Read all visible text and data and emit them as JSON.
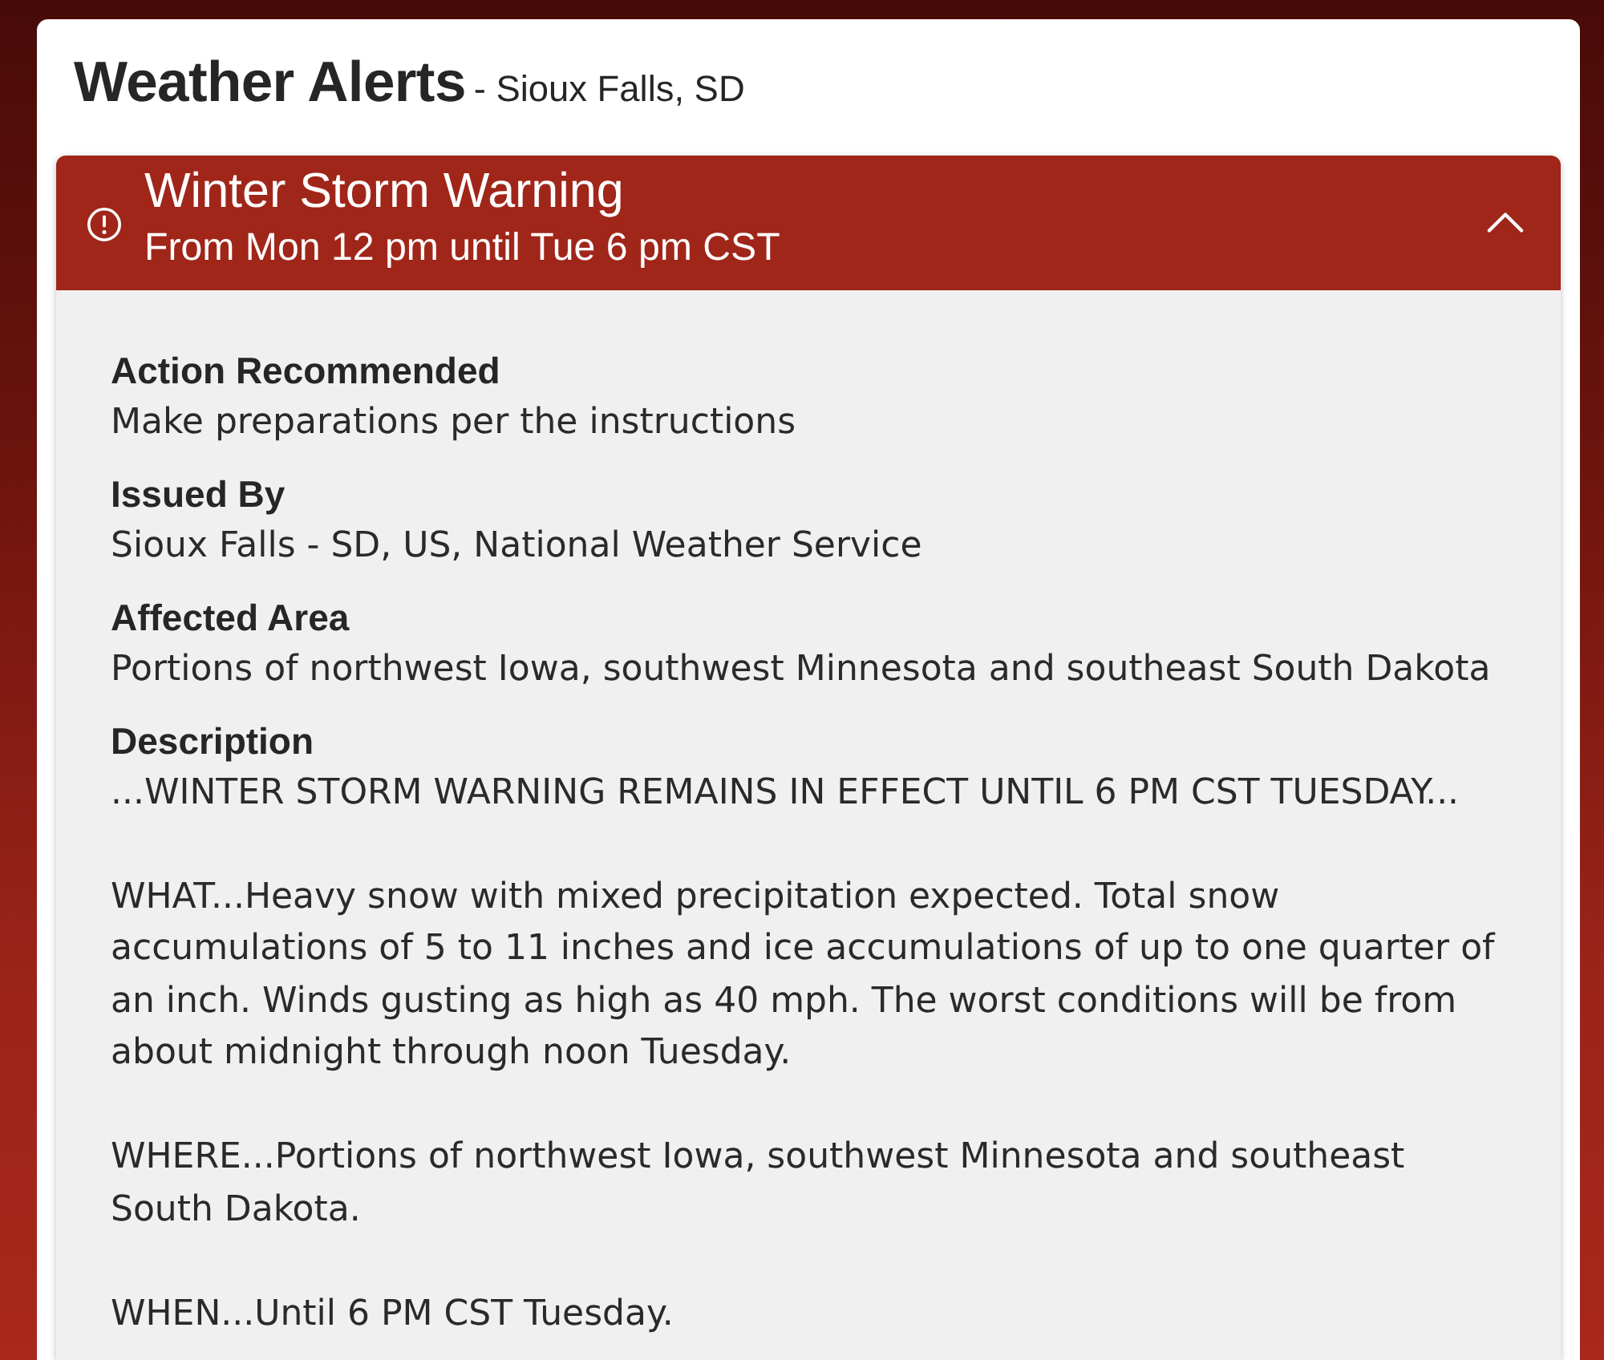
{
  "header": {
    "title": "Weather Alerts",
    "location": "- Sioux Falls, SD"
  },
  "alerts": [
    {
      "title": "Winter Storm Warning",
      "period": "From Mon 12 pm until Tue 6 pm CST",
      "expanded": true,
      "details": [
        {
          "label": "Action Recommended",
          "paragraphs": [
            "Make preparations per the instructions"
          ]
        },
        {
          "label": "Issued By",
          "paragraphs": [
            "Sioux Falls - SD, US, National Weather Service"
          ]
        },
        {
          "label": "Affected Area",
          "paragraphs": [
            "Portions of northwest Iowa, southwest Minnesota and southeast South Dakota"
          ]
        },
        {
          "label": "Description",
          "paragraphs": [
            "...WINTER STORM WARNING REMAINS IN EFFECT UNTIL 6 PM CST TUESDAY...",
            "WHAT...Heavy snow with mixed precipitation expected. Total snow accumulations of 5 to 11 inches and ice accumulations of up to one quarter of an inch. Winds gusting as high as 40 mph. The worst conditions will be from about midnight through noon Tuesday.",
            "WHERE...Portions of northwest Iowa, southwest Minnesota and southeast South Dakota.",
            "WHEN...Until 6 PM CST Tuesday."
          ]
        }
      ]
    }
  ]
}
